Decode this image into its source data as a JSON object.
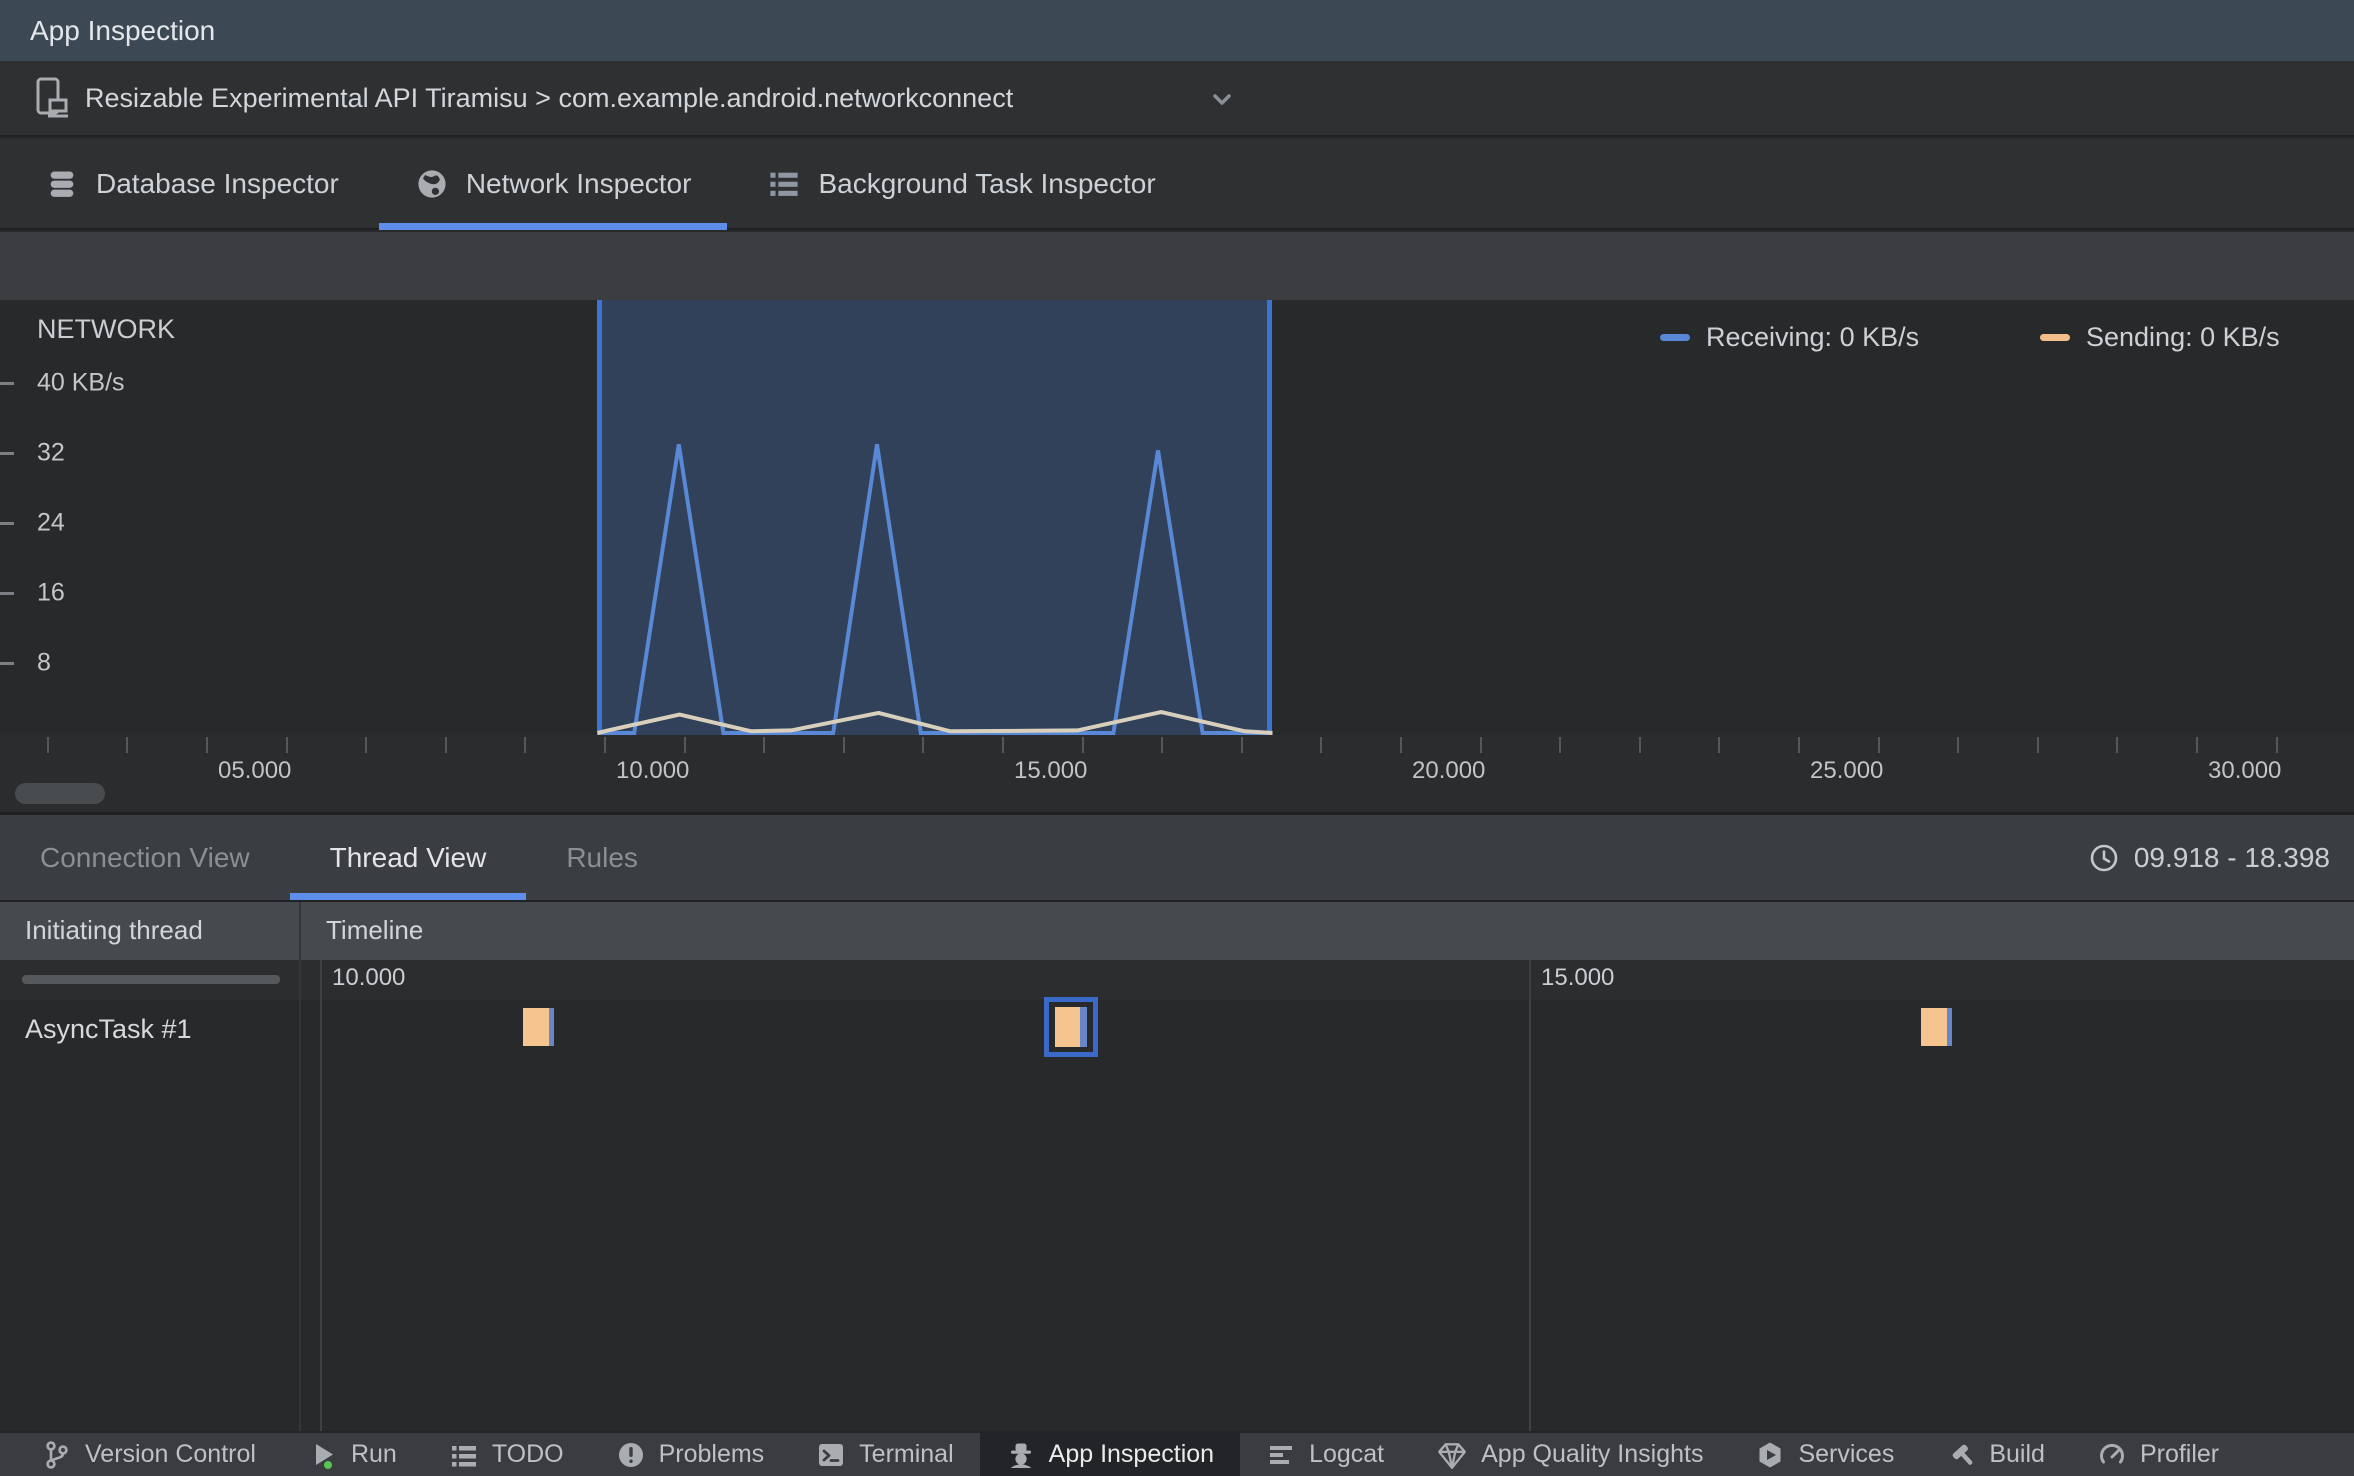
{
  "titlebar": {
    "title": "App Inspection"
  },
  "device_bar": {
    "selection": "Resizable Experimental API Tiramisu > com.example.android.networkconnect"
  },
  "inspector_tabs": {
    "items": [
      {
        "label": "Database Inspector",
        "icon": "database-icon",
        "active": false
      },
      {
        "label": "Network Inspector",
        "icon": "globe-icon",
        "active": true
      },
      {
        "label": "Background Task Inspector",
        "icon": "tasklist-icon",
        "active": false
      }
    ]
  },
  "network_chart": {
    "title": "NETWORK",
    "legend": [
      {
        "name": "receiving",
        "label": "Receiving: 0 KB/s",
        "color": "#5988d6"
      },
      {
        "name": "sending",
        "label": "Sending: 0 KB/s",
        "color": "#f2be89"
      }
    ],
    "selection": {
      "start_s": 9.918,
      "end_s": 18.398
    },
    "chart_data": {
      "type": "area",
      "x_unit": "seconds",
      "y_unit": "KB/s",
      "ylim": [
        0,
        48
      ],
      "y_ticks": [
        {
          "value": 40,
          "label": "40 KB/s"
        },
        {
          "value": 32,
          "label": "32"
        },
        {
          "value": 24,
          "label": "24"
        },
        {
          "value": 16,
          "label": "16"
        },
        {
          "value": 8,
          "label": "8"
        }
      ],
      "x_major_ticks": [
        {
          "t": 5,
          "label": "05.000"
        },
        {
          "t": 10,
          "label": "10.000"
        },
        {
          "t": 15,
          "label": "15.000"
        },
        {
          "t": 20,
          "label": "20.000"
        },
        {
          "t": 25,
          "label": "25.000"
        },
        {
          "t": 30,
          "label": "30.000"
        }
      ],
      "x_minor_tick_every_s": 1,
      "series": [
        {
          "name": "Receiving",
          "color": "#5988d6",
          "points": [
            [
              9.918,
              0
            ],
            [
              10.38,
              0
            ],
            [
              10.94,
              33
            ],
            [
              11.5,
              0
            ],
            [
              12.88,
              0
            ],
            [
              13.43,
              33
            ],
            [
              13.98,
              0
            ],
            [
              16.4,
              0
            ],
            [
              16.96,
              32.3
            ],
            [
              17.52,
              0
            ],
            [
              18.398,
              0
            ]
          ]
        },
        {
          "name": "Sending",
          "color": "#d8cfbc",
          "points": [
            [
              9.918,
              0
            ],
            [
              10.05,
              0.3
            ],
            [
              10.95,
              2.1
            ],
            [
              11.85,
              0.2
            ],
            [
              12.35,
              0.3
            ],
            [
              13.45,
              2.3
            ],
            [
              14.35,
              0.2
            ],
            [
              15.95,
              0.3
            ],
            [
              17.0,
              2.4
            ],
            [
              18.05,
              0.2
            ],
            [
              18.398,
              0
            ]
          ]
        }
      ]
    }
  },
  "thread_panel": {
    "tabs": [
      {
        "label": "Connection View",
        "active": false
      },
      {
        "label": "Thread View",
        "active": true
      },
      {
        "label": "Rules",
        "active": false
      }
    ],
    "time_range": "09.918 - 18.398",
    "columns": {
      "thread": "Initiating thread",
      "timeline": "Timeline"
    },
    "timeline_ticks": [
      {
        "t": 10,
        "label": "10.000"
      },
      {
        "t": 15,
        "label": "15.000"
      }
    ],
    "rows": [
      {
        "thread": "AsyncTask #1",
        "events": [
          {
            "t": 10.84,
            "selected": false
          },
          {
            "t": 13.04,
            "selected": true
          },
          {
            "t": 16.62,
            "selected": false
          }
        ]
      }
    ]
  },
  "bottom_bar": {
    "items": [
      {
        "label": "Version Control",
        "icon": "branch-icon",
        "active": false
      },
      {
        "label": "Run",
        "icon": "run-icon",
        "active": false
      },
      {
        "label": "TODO",
        "icon": "todo-icon",
        "active": false
      },
      {
        "label": "Problems",
        "icon": "problems-icon",
        "active": false
      },
      {
        "label": "Terminal",
        "icon": "terminal-icon",
        "active": false
      },
      {
        "label": "App Inspection",
        "icon": "spy-icon",
        "active": true
      },
      {
        "label": "Logcat",
        "icon": "logcat-icon",
        "active": false
      },
      {
        "label": "App Quality Insights",
        "icon": "diamond-icon",
        "active": false
      },
      {
        "label": "Services",
        "icon": "services-icon",
        "active": false
      },
      {
        "label": "Build",
        "icon": "build-icon",
        "active": false
      },
      {
        "label": "Profiler",
        "icon": "profiler-icon",
        "active": false
      }
    ]
  },
  "colors": {
    "accent_blue": "#5e8eea",
    "selection_border": "#3c74d2",
    "receiving": "#5988d6",
    "sending_legend": "#f2be89",
    "sending_line": "#d8cfbc",
    "marker_fill": "#f5c48f",
    "marker_strip": "#6787c8",
    "marker_selected_border": "#3a69c8",
    "run_dot_green": "#57c454"
  }
}
